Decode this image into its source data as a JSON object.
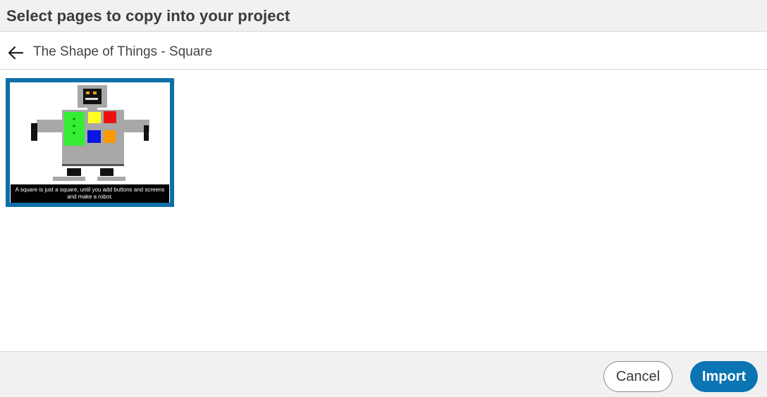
{
  "header": {
    "title": "Select pages to copy into your project"
  },
  "subbar": {
    "back_icon": "arrow-left-icon",
    "title": "The Shape of Things - Square"
  },
  "pages": [
    {
      "thumbnail_caption": "A square is just a square, until you add buttons and screens and make a robot.",
      "selected": true
    }
  ],
  "footer": {
    "cancel_label": "Cancel",
    "import_label": "Import"
  },
  "colors": {
    "accent": "#0b74b3",
    "selection_border": "#0d6fa6",
    "header_bg": "#f1f1f1"
  }
}
